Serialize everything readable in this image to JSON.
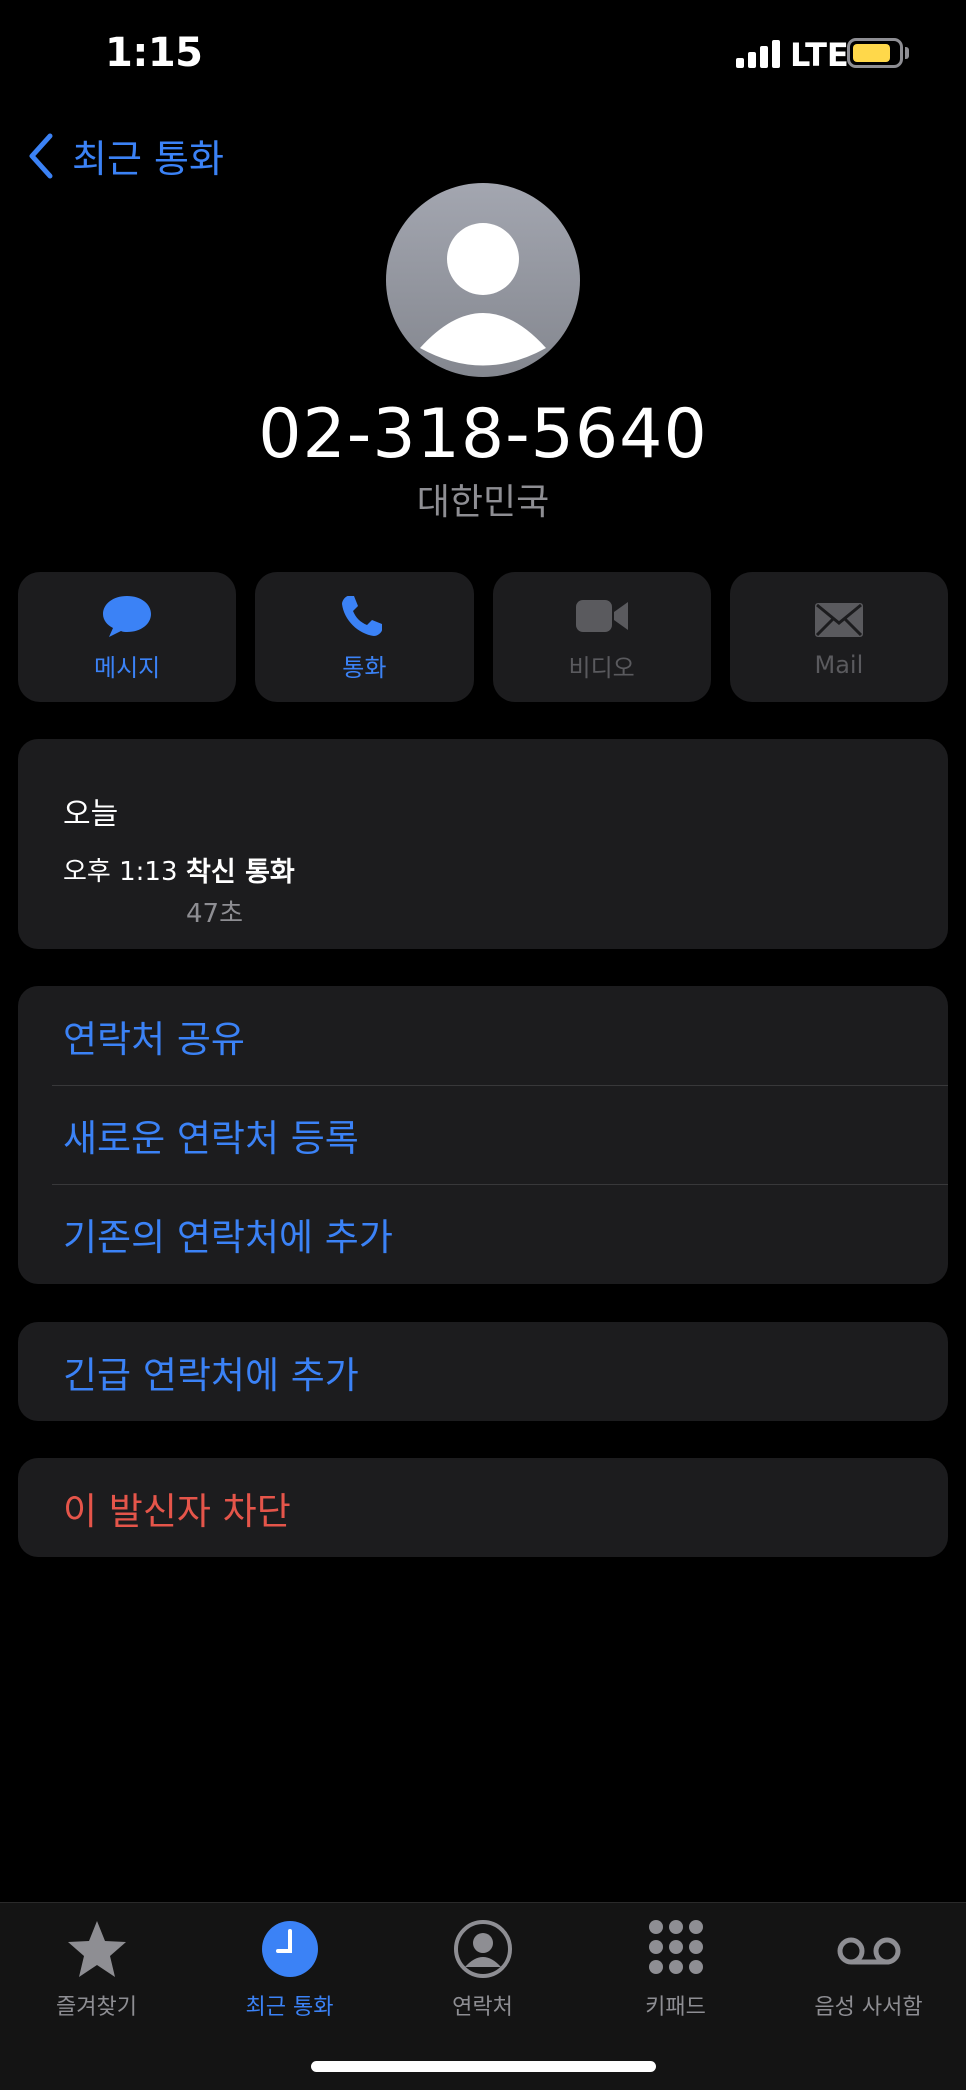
{
  "status_bar": {
    "time": "1:15",
    "network": "LTE",
    "battery_level": 0.85
  },
  "nav": {
    "back_label": "최근 통화"
  },
  "contact": {
    "phone_number": "02-318-5640",
    "country": "대한민국"
  },
  "actions": [
    {
      "label": "메시지",
      "icon": "message-icon",
      "enabled": true
    },
    {
      "label": "통화",
      "icon": "phone-icon",
      "enabled": true
    },
    {
      "label": "비디오",
      "icon": "video-icon",
      "enabled": false
    },
    {
      "label": "Mail",
      "icon": "mail-icon",
      "enabled": false
    }
  ],
  "call_history": {
    "day": "오늘",
    "time": "오후 1:13",
    "type": "착신 통화",
    "duration": "47초"
  },
  "options": [
    "연락처 공유",
    "새로운 연락처 등록",
    "기존의 연락처에 추가"
  ],
  "emergency_label": "긴급 연락처에 추가",
  "block_label": "이 발신자 차단",
  "tabs": [
    {
      "label": "즐겨찾기",
      "icon": "star-icon",
      "active": false
    },
    {
      "label": "최근 통화",
      "icon": "clock-icon",
      "active": true
    },
    {
      "label": "연락처",
      "icon": "person-circle-icon",
      "active": false
    },
    {
      "label": "키패드",
      "icon": "keypad-icon",
      "active": false
    },
    {
      "label": "음성 사서함",
      "icon": "voicemail-icon",
      "active": false
    }
  ],
  "colors": {
    "accent": "#3b82f6",
    "destructive": "#e5554a",
    "battery": "#ffd84a",
    "card": "#1c1c1e"
  }
}
